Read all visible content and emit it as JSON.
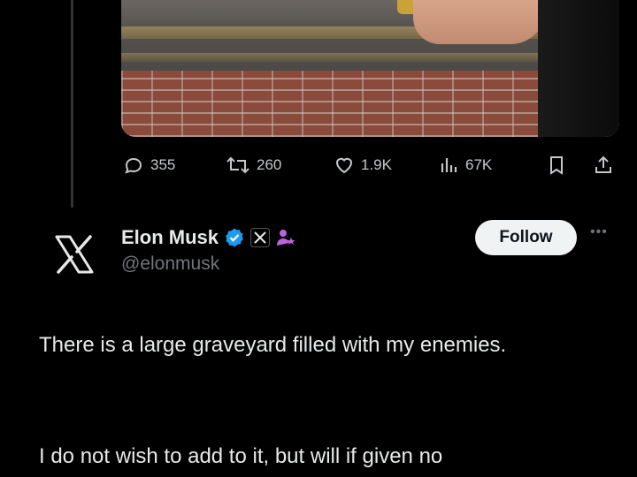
{
  "post": {
    "actions": {
      "replies": "355",
      "reposts": "260",
      "likes": "1.9K",
      "views": "67K"
    },
    "author": {
      "name": "Elon Musk",
      "handle": "@elonmusk",
      "badges": [
        "verified-checkmark-icon",
        "x-affiliate-icon",
        "purple-badge-icon"
      ]
    },
    "follow_label": "Follow",
    "more_label": "•••",
    "text": {
      "paragraph1": "There is a large graveyard filled with my enemies.",
      "paragraph2": "I do not wish to add to it, but will if given no"
    }
  },
  "colors": {
    "background": "#000000",
    "text": "#e7e9ea",
    "muted": "#71767b",
    "verified": "#1d9bf0",
    "affiliate_badge": "#c060e0"
  }
}
